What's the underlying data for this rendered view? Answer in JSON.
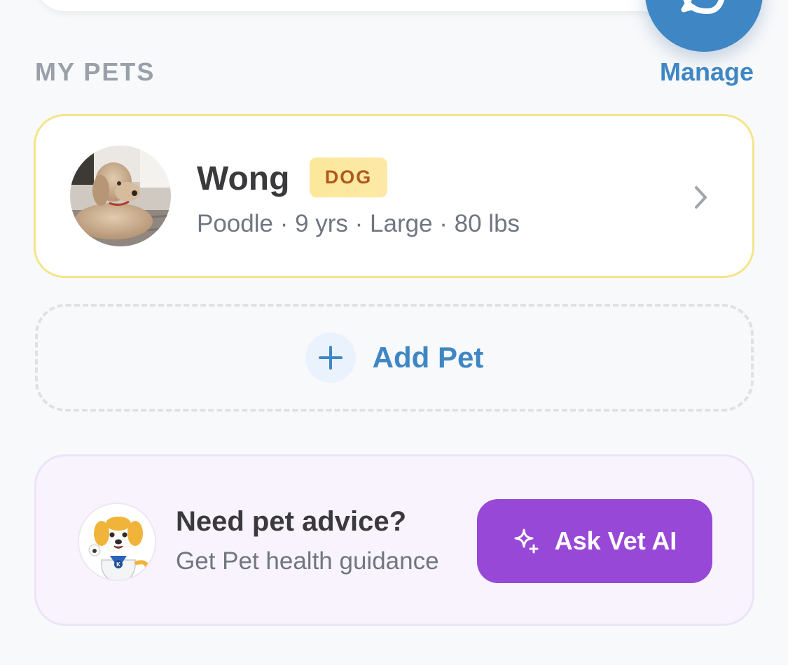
{
  "header": {
    "chat_button": {
      "icon": "chat-bubble-icon"
    }
  },
  "pets_section": {
    "title": "MY PETS",
    "manage_label": "Manage"
  },
  "pets": [
    {
      "name": "Wong",
      "species": "DOG",
      "details": "Poodle · 9 yrs · Large · 80 lbs",
      "photo_icon": "pet-photo",
      "chevron_icon": "chevron-right-icon"
    }
  ],
  "add_pet": {
    "label": "Add Pet",
    "icon": "plus-icon"
  },
  "advice": {
    "title": "Need pet advice?",
    "subtitle": "Get Pet health guidance",
    "button_label": "Ask Vet AI",
    "button_icon": "sparkles-icon",
    "mascot_icon": "vet-dog-mascot"
  },
  "colors": {
    "background": "#f8f9fb",
    "accent_blue": "#3f86c4",
    "purple": "#9848d6",
    "badge_bg": "#fbe89a",
    "badge_text": "#b0581d",
    "card_border_yellow": "#f3e58a",
    "advice_bg": "#f8f3fd"
  }
}
